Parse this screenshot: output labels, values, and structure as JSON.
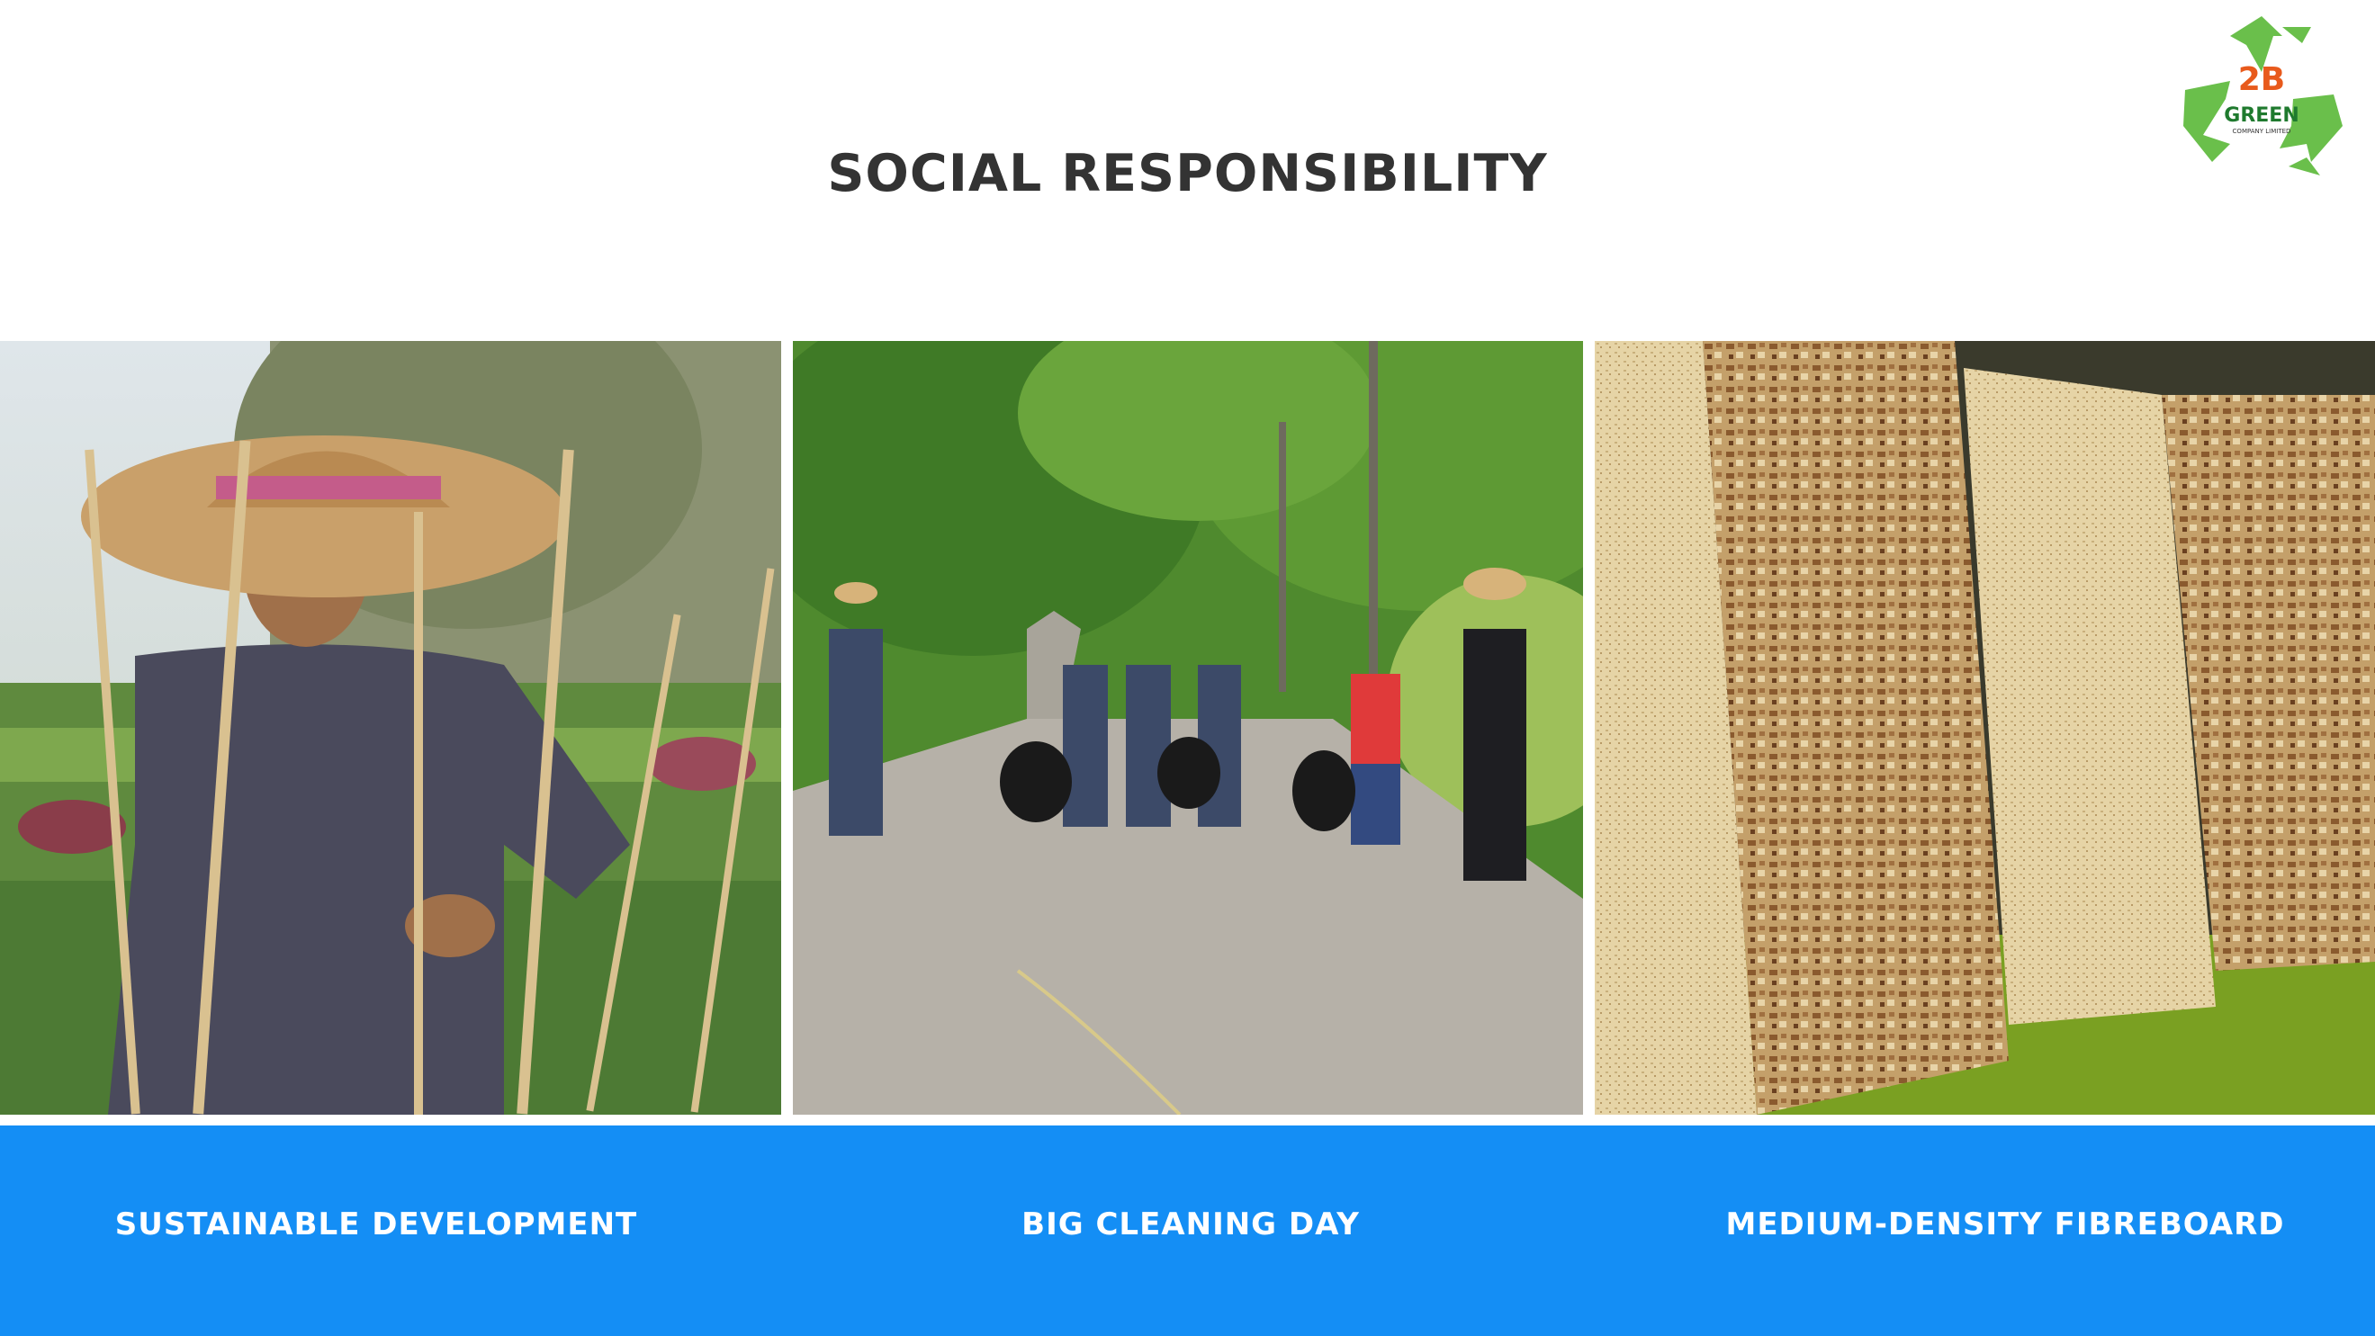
{
  "header": {
    "title": "SOCIAL RESPONSIBILITY"
  },
  "logo": {
    "brand_top": "2B",
    "brand_name": "GREEN",
    "brand_sub": "COMPANY LIMITED",
    "icon": "recycle-icon",
    "colors": {
      "arrows": "#6abf4b",
      "two": "#e85a1c",
      "b": "#d7262c",
      "green_text": "#1f7a2e"
    }
  },
  "photos": [
    {
      "icon": "farmer-photo"
    },
    {
      "icon": "road-cleanup-photo"
    },
    {
      "icon": "fibreboard-photo"
    }
  ],
  "captions": [
    "SUSTAINABLE DEVELOPMENT",
    "BIG CLEANING DAY",
    "MEDIUM-DENSITY FIBREBOARD"
  ],
  "theme": {
    "band_color": "#148ef5",
    "title_color": "#333333"
  }
}
